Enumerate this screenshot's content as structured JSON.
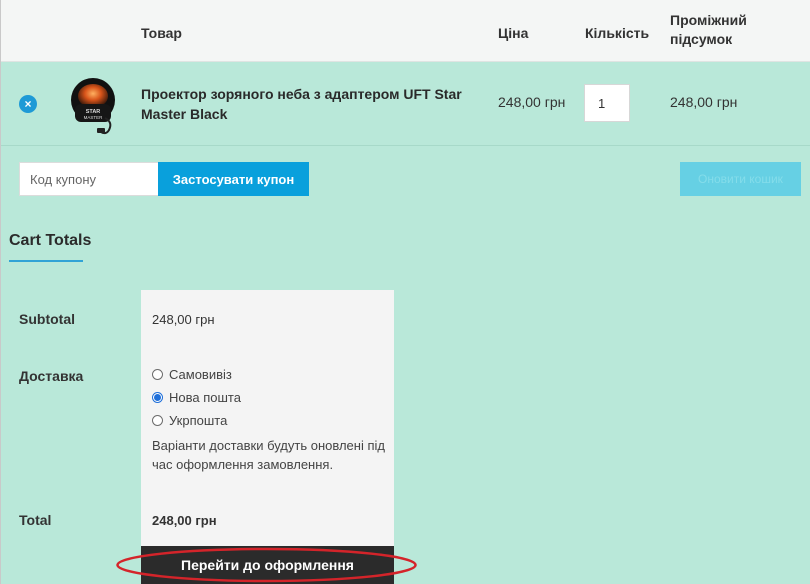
{
  "table_header": {
    "product": "Товар",
    "price": "Ціна",
    "quantity": "Кількість",
    "subtotal": "Проміжний підсумок"
  },
  "item": {
    "remove_symbol": "×",
    "name": "Проектор зоряного неба з адаптером UFT Star Master Black",
    "price": "248,00 грн",
    "quantity": "1",
    "line_subtotal": "248,00 грн",
    "thumbnail_text": "STAR MASTER"
  },
  "coupon": {
    "placeholder": "Код купону",
    "apply_label": "Застосувати купон",
    "update_label": "Оновити кошик"
  },
  "cart_totals": {
    "title": "Cart Totals",
    "subtotal_label": "Subtotal",
    "subtotal_value": "248,00 грн",
    "shipping_label": "Доставка",
    "shipping_options": [
      {
        "label": "Самовивіз",
        "selected": false
      },
      {
        "label": "Нова пошта",
        "selected": true
      },
      {
        "label": "Укрпошта",
        "selected": false
      }
    ],
    "shipping_note": "Варіанти доставки будуть оновлені під час оформлення замовлення.",
    "total_label": "Total",
    "total_value": "248,00 грн",
    "checkout_label": "Перейти до оформлення"
  },
  "colors": {
    "background": "#b9e8d9",
    "accent_blue": "#09a0dc",
    "highlight_red": "#d4242a",
    "checkout_dark": "#2b2b2b"
  }
}
